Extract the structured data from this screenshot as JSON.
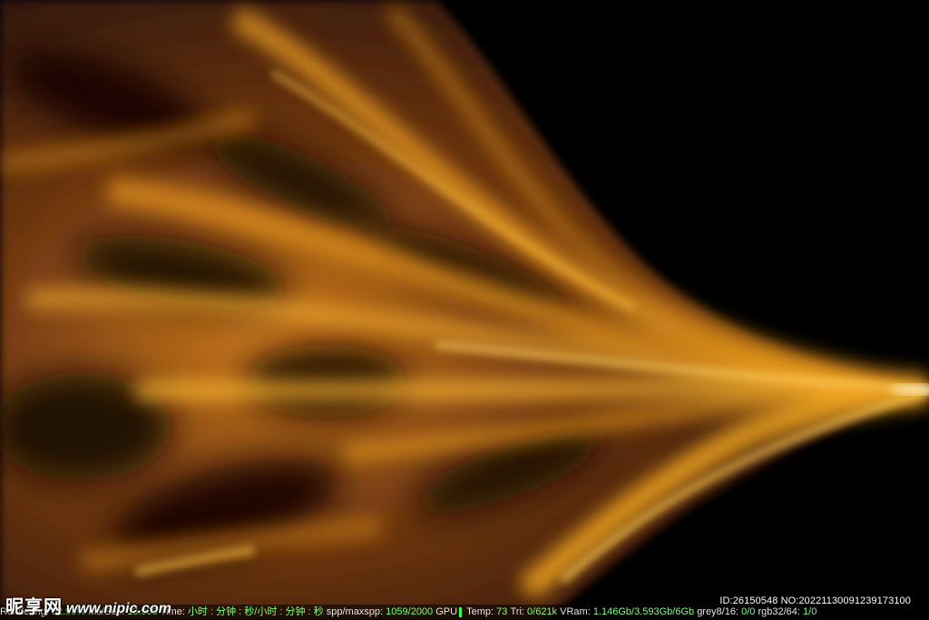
{
  "watermark": {
    "brand": "昵享网",
    "url": "www.nipic.com"
  },
  "id_line": "ID:26150548 NO:20221130091239173100",
  "status": {
    "rendering_label": "Rendering:",
    "rendering_value": "52.95%",
    "ms_label": "Ms/Sec:",
    "ms_value": "13.905",
    "time_label": "Time:",
    "time_value": "小时 : 分钟 : 秒/小时 : 分钟 : 秒",
    "spp_label": "spp/maxspp:",
    "spp_value": "1059/2000",
    "gpu_label": "GPU",
    "temp_label": "Temp:",
    "temp_value": "73",
    "tri_label": "Tri:",
    "tri_value": "0/621k",
    "vram_label": "VRam:",
    "vram_value": "1.146Gb/3.593Gb/6Gb",
    "grey_label": "grey8/16:",
    "grey_value": "0/0",
    "rgb_label": "rgb32/64:",
    "rgb_value": "1/0"
  },
  "colors": {
    "background": "#000000",
    "streak_gold": "#f0a020",
    "streak_bright": "#ffd060",
    "streak_dark": "#3a1a08",
    "status_green": "#7cff7c"
  }
}
